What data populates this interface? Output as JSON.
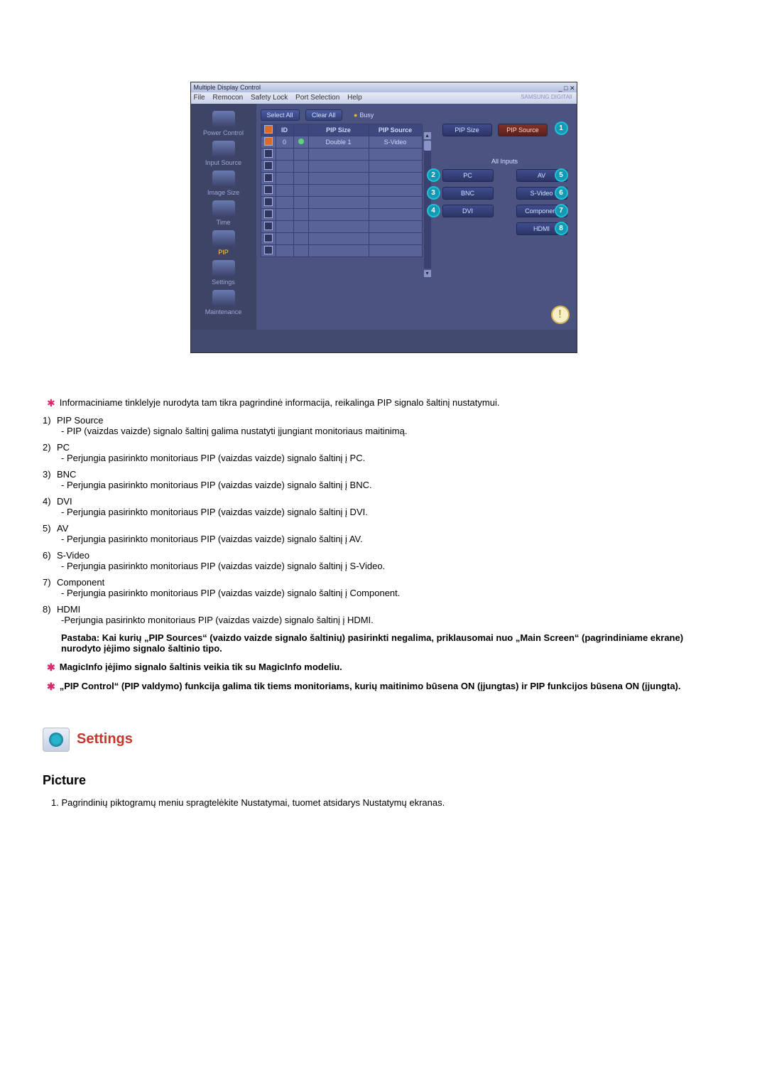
{
  "app": {
    "title": "Multiple Display Control",
    "window_buttons": "_ □ ✕",
    "menu": [
      "File",
      "Remocon",
      "Safety Lock",
      "Port Selection",
      "Help"
    ],
    "brand": "SAMSUNG DIGITAll",
    "toolbar": {
      "select_all": "Select All",
      "clear_all": "Clear All",
      "busy": "Busy"
    },
    "sidebar": [
      {
        "label": "Power Control"
      },
      {
        "label": "Input Source"
      },
      {
        "label": "Image Size"
      },
      {
        "label": "Time"
      },
      {
        "label": "PIP"
      },
      {
        "label": "Settings"
      },
      {
        "label": "Maintenance"
      }
    ],
    "table": {
      "headers": [
        "",
        "ID",
        "",
        "PIP Size",
        "PIP Source"
      ],
      "rows": [
        {
          "checked": true,
          "id": "0",
          "dot": true,
          "size": "Double 1",
          "source": "S-Video"
        },
        {
          "checked": false
        },
        {
          "checked": false
        },
        {
          "checked": false
        },
        {
          "checked": false
        },
        {
          "checked": false
        },
        {
          "checked": false
        },
        {
          "checked": false
        },
        {
          "checked": false
        },
        {
          "checked": false
        }
      ]
    },
    "right": {
      "pip_size": "PIP Size",
      "pip_source": "PIP Source",
      "all_inputs": "All Inputs",
      "buttons": {
        "pc": "PC",
        "av": "AV",
        "bnc": "BNC",
        "svideo": "S-Video",
        "dvi": "DVI",
        "component": "Component",
        "hdmi": "HDMI"
      }
    },
    "badges": {
      "b1": "1",
      "b2": "2",
      "b3": "3",
      "b4": "4",
      "b5": "5",
      "b6": "6",
      "b7": "7",
      "b8": "8"
    },
    "warn": "!"
  },
  "intro_star": "Informaciniame tinklelyje nurodyta tam tikra pagrindinė informacija, reikalinga PIP signalo šaltinį nustatymui.",
  "list": [
    {
      "n": "1)",
      "title": "PIP Source",
      "desc": "- PIP (vaizdas vaizde) signalo šaltinį galima nustatyti įjungiant monitoriaus maitinimą."
    },
    {
      "n": "2)",
      "title": "PC",
      "desc": "- Perjungia pasirinkto monitoriaus PIP (vaizdas vaizde) signalo šaltinį į PC."
    },
    {
      "n": "3)",
      "title": "BNC",
      "desc": "- Perjungia pasirinkto monitoriaus PIP (vaizdas vaizde) signalo šaltinį į BNC."
    },
    {
      "n": "4)",
      "title": "DVI",
      "desc": "- Perjungia pasirinkto monitoriaus PIP (vaizdas vaizde) signalo šaltinį į DVI."
    },
    {
      "n": "5)",
      "title": "AV",
      "desc": "- Perjungia pasirinkto monitoriaus PIP (vaizdas vaizde) signalo šaltinį į AV."
    },
    {
      "n": "6)",
      "title": "S-Video",
      "desc": "- Perjungia pasirinkto monitoriaus PIP (vaizdas vaizde) signalo šaltinį į S-Video."
    },
    {
      "n": "7)",
      "title": "Component",
      "desc": "- Perjungia pasirinkto monitoriaus PIP (vaizdas vaizde) signalo šaltinį į Component."
    },
    {
      "n": "8)",
      "title": "HDMI",
      "desc": "-Perjungia pasirinkto monitoriaus PIP (vaizdas vaizde) signalo šaltinį į HDMI."
    }
  ],
  "note": "Pastaba: Kai kurių „PIP Sources“ (vaizdo vaizde signalo šaltinių) pasirinkti negalima, priklausomai nuo „Main Screen“ (pagrindiniame ekrane) nurodyto įėjimo signalo šaltinio tipo.",
  "star2": "MagicInfo įėjimo signalo šaltinis veikia tik su MagicInfo modeliu.",
  "star3": "„PIP Control“ (PIP valdymo) funkcija galima tik tiems monitoriams, kurių maitinimo būsena ON (įjungtas) ir PIP funkcijos būsena ON (įjungta).",
  "settings_heading": "Settings",
  "picture_heading": "Picture",
  "picture_step1": "1. Pagrindinių piktogramų meniu spragtelėkite Nustatymai, tuomet atsidarys Nustatymų ekranas."
}
